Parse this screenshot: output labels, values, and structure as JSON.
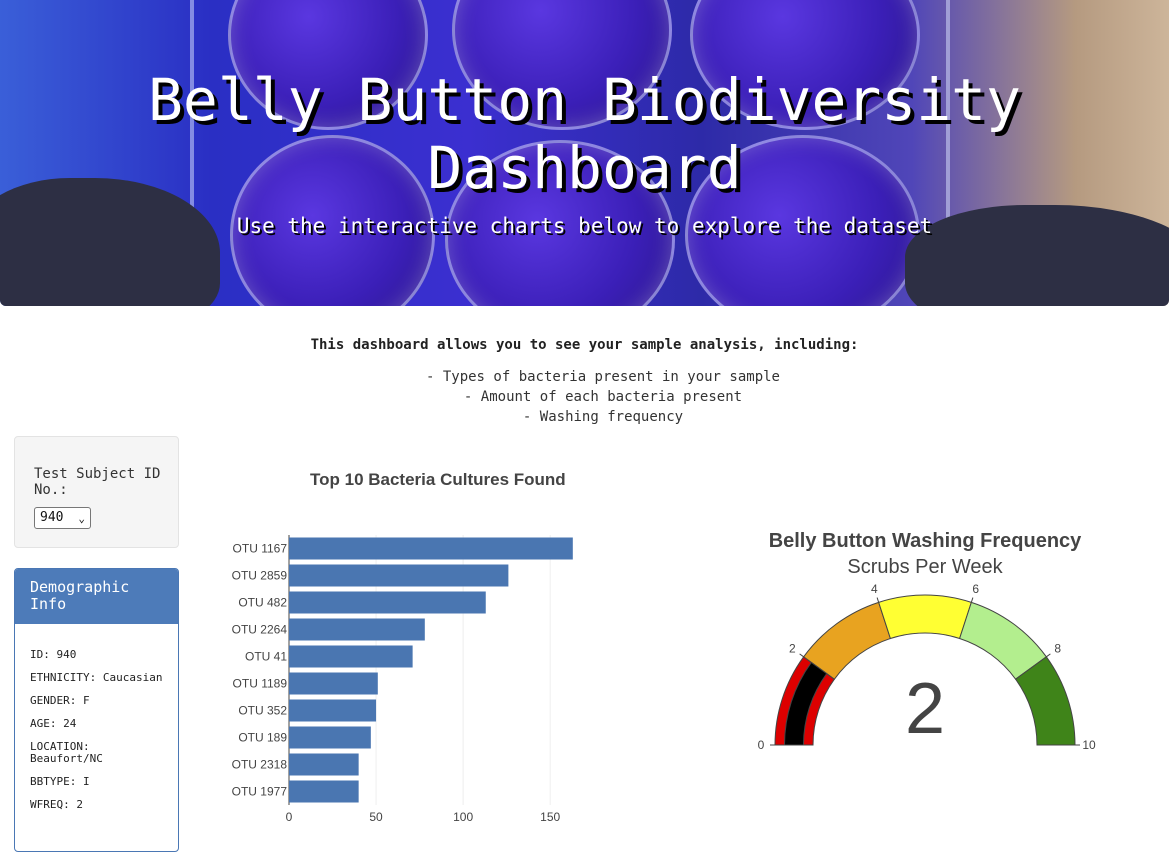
{
  "header": {
    "title": "Belly Button Biodiversity Dashboard",
    "subtitle": "Use the interactive charts below to explore the dataset"
  },
  "intro": {
    "heading": "This dashboard allows you to see your sample analysis, including:",
    "items": [
      "- Types of bacteria present in your sample",
      "- Amount of each bacteria present",
      "- Washing frequency"
    ]
  },
  "selector": {
    "label": "Test Subject ID No.:",
    "selected": "940"
  },
  "demographics": {
    "title": "Demographic Info",
    "rows": [
      "ID: 940",
      "ETHNICITY: Caucasian",
      "GENDER: F",
      "AGE: 24",
      "LOCATION: Beaufort/NC",
      "BBTYPE: I",
      "WFREQ: 2"
    ]
  },
  "chart_data": [
    {
      "type": "bar",
      "orientation": "horizontal",
      "title": "Top 10 Bacteria Cultures Found",
      "categories": [
        "OTU 1167",
        "OTU 2859",
        "OTU 482",
        "OTU 2264",
        "OTU 41",
        "OTU 1189",
        "OTU 352",
        "OTU 189",
        "OTU 2318",
        "OTU 1977"
      ],
      "values": [
        163,
        126,
        113,
        78,
        71,
        51,
        50,
        47,
        40,
        40
      ],
      "xlim": [
        0,
        170
      ],
      "xticks": [
        0,
        50,
        100,
        150
      ],
      "color": "#4a76b1",
      "grid": true
    },
    {
      "type": "gauge",
      "title": "Belly Button Washing Frequency",
      "subtitle": "Scrubs Per Week",
      "value": 2,
      "display_value": "2",
      "range": [
        0,
        10
      ],
      "ticks": [
        0,
        2,
        4,
        6,
        8,
        10
      ],
      "steps": [
        {
          "range": [
            0,
            2
          ],
          "color": "#dd0000"
        },
        {
          "range": [
            2,
            4
          ],
          "color": "#e8a320"
        },
        {
          "range": [
            4,
            6
          ],
          "color": "#ffff33"
        },
        {
          "range": [
            6,
            8
          ],
          "color": "#b3ee8e"
        },
        {
          "range": [
            8,
            10
          ],
          "color": "#3f8419"
        }
      ],
      "bar_color": "#000000"
    }
  ]
}
